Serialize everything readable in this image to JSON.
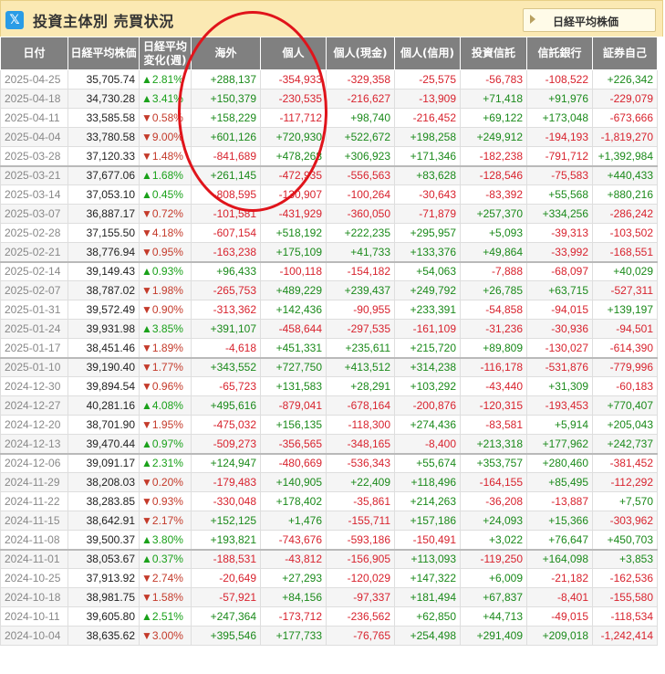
{
  "header": {
    "title": "投資主体別 売買状況",
    "nikkei_button": "日経平均株価"
  },
  "columns": [
    "日付",
    "日経平均株価",
    "日経平均\n変化(週)",
    "海外",
    "個人",
    "個人(現金)",
    "個人(信用)",
    "投資信託",
    "信託銀行",
    "証券自己"
  ],
  "rows": [
    {
      "date": "2025-04-25",
      "nikkei": "35,705.74",
      "dir": "up",
      "chg": "2.81%",
      "vals": [
        "+288,137",
        "-354,933",
        "-329,358",
        "-25,575",
        "-56,783",
        "-108,522",
        "+226,342"
      ]
    },
    {
      "date": "2025-04-18",
      "nikkei": "34,730.28",
      "dir": "up",
      "chg": "3.41%",
      "vals": [
        "+150,379",
        "-230,535",
        "-216,627",
        "-13,909",
        "+71,418",
        "+91,976",
        "-229,079"
      ]
    },
    {
      "date": "2025-04-11",
      "nikkei": "33,585.58",
      "dir": "down",
      "chg": "0.58%",
      "vals": [
        "+158,229",
        "-117,712",
        "+98,740",
        "-216,452",
        "+69,122",
        "+173,048",
        "-673,666"
      ]
    },
    {
      "date": "2025-04-04",
      "nikkei": "33,780.58",
      "dir": "down",
      "chg": "9.00%",
      "vals": [
        "+601,126",
        "+720,930",
        "+522,672",
        "+198,258",
        "+249,912",
        "-194,193",
        "-1,819,270"
      ]
    },
    {
      "date": "2025-03-28",
      "nikkei": "37,120.33",
      "dir": "down",
      "chg": "1.48%",
      "vals": [
        "-841,689",
        "+478,268",
        "+306,923",
        "+171,346",
        "-182,238",
        "-791,712",
        "+1,392,984"
      ]
    },
    {
      "date": "2025-03-21",
      "nikkei": "37,677.06",
      "dir": "up",
      "chg": "1.68%",
      "vals": [
        "+261,145",
        "-472,935",
        "-556,563",
        "+83,628",
        "-128,546",
        "-75,583",
        "+440,433"
      ]
    },
    {
      "date": "2025-03-14",
      "nikkei": "37,053.10",
      "dir": "up",
      "chg": "0.45%",
      "vals": [
        "-808,595",
        "-130,907",
        "-100,264",
        "-30,643",
        "-83,392",
        "+55,568",
        "+880,216"
      ]
    },
    {
      "date": "2025-03-07",
      "nikkei": "36,887.17",
      "dir": "down",
      "chg": "0.72%",
      "vals": [
        "-101,581",
        "-431,929",
        "-360,050",
        "-71,879",
        "+257,370",
        "+334,256",
        "-286,242"
      ]
    },
    {
      "date": "2025-02-28",
      "nikkei": "37,155.50",
      "dir": "down",
      "chg": "4.18%",
      "vals": [
        "-607,154",
        "+518,192",
        "+222,235",
        "+295,957",
        "+5,093",
        "-39,313",
        "-103,502"
      ]
    },
    {
      "date": "2025-02-21",
      "nikkei": "38,776.94",
      "dir": "down",
      "chg": "0.95%",
      "vals": [
        "-163,238",
        "+175,109",
        "+41,733",
        "+133,376",
        "+49,864",
        "-33,992",
        "-168,551"
      ]
    },
    {
      "date": "2025-02-14",
      "nikkei": "39,149.43",
      "dir": "up",
      "chg": "0.93%",
      "vals": [
        "+96,433",
        "-100,118",
        "-154,182",
        "+54,063",
        "-7,888",
        "-68,097",
        "+40,029"
      ]
    },
    {
      "date": "2025-02-07",
      "nikkei": "38,787.02",
      "dir": "down",
      "chg": "1.98%",
      "vals": [
        "-265,753",
        "+489,229",
        "+239,437",
        "+249,792",
        "+26,785",
        "+63,715",
        "-527,311"
      ]
    },
    {
      "date": "2025-01-31",
      "nikkei": "39,572.49",
      "dir": "down",
      "chg": "0.90%",
      "vals": [
        "-313,362",
        "+142,436",
        "-90,955",
        "+233,391",
        "-54,858",
        "-94,015",
        "+139,197"
      ]
    },
    {
      "date": "2025-01-24",
      "nikkei": "39,931.98",
      "dir": "up",
      "chg": "3.85%",
      "vals": [
        "+391,107",
        "-458,644",
        "-297,535",
        "-161,109",
        "-31,236",
        "-30,936",
        "-94,501"
      ]
    },
    {
      "date": "2025-01-17",
      "nikkei": "38,451.46",
      "dir": "down",
      "chg": "1.89%",
      "vals": [
        "-4,618",
        "+451,331",
        "+235,611",
        "+215,720",
        "+89,809",
        "-130,027",
        "-614,390"
      ]
    },
    {
      "date": "2025-01-10",
      "nikkei": "39,190.40",
      "dir": "down",
      "chg": "1.77%",
      "vals": [
        "+343,552",
        "+727,750",
        "+413,512",
        "+314,238",
        "-116,178",
        "-531,876",
        "-779,996"
      ]
    },
    {
      "date": "2024-12-30",
      "nikkei": "39,894.54",
      "dir": "down",
      "chg": "0.96%",
      "vals": [
        "-65,723",
        "+131,583",
        "+28,291",
        "+103,292",
        "-43,440",
        "+31,309",
        "-60,183"
      ]
    },
    {
      "date": "2024-12-27",
      "nikkei": "40,281.16",
      "dir": "up",
      "chg": "4.08%",
      "vals": [
        "+495,616",
        "-879,041",
        "-678,164",
        "-200,876",
        "-120,315",
        "-193,453",
        "+770,407"
      ]
    },
    {
      "date": "2024-12-20",
      "nikkei": "38,701.90",
      "dir": "down",
      "chg": "1.95%",
      "vals": [
        "-475,032",
        "+156,135",
        "-118,300",
        "+274,436",
        "-83,581",
        "+5,914",
        "+205,043"
      ]
    },
    {
      "date": "2024-12-13",
      "nikkei": "39,470.44",
      "dir": "up",
      "chg": "0.97%",
      "vals": [
        "-509,273",
        "-356,565",
        "-348,165",
        "-8,400",
        "+213,318",
        "+177,962",
        "+242,737"
      ]
    },
    {
      "date": "2024-12-06",
      "nikkei": "39,091.17",
      "dir": "up",
      "chg": "2.31%",
      "vals": [
        "+124,947",
        "-480,669",
        "-536,343",
        "+55,674",
        "+353,757",
        "+280,460",
        "-381,452"
      ]
    },
    {
      "date": "2024-11-29",
      "nikkei": "38,208.03",
      "dir": "down",
      "chg": "0.20%",
      "vals": [
        "-179,483",
        "+140,905",
        "+22,409",
        "+118,496",
        "-164,155",
        "+85,495",
        "-112,292"
      ]
    },
    {
      "date": "2024-11-22",
      "nikkei": "38,283.85",
      "dir": "down",
      "chg": "0.93%",
      "vals": [
        "-330,048",
        "+178,402",
        "-35,861",
        "+214,263",
        "-36,208",
        "-13,887",
        "+7,570"
      ]
    },
    {
      "date": "2024-11-15",
      "nikkei": "38,642.91",
      "dir": "down",
      "chg": "2.17%",
      "vals": [
        "+152,125",
        "+1,476",
        "-155,711",
        "+157,186",
        "+24,093",
        "+15,366",
        "-303,962"
      ]
    },
    {
      "date": "2024-11-08",
      "nikkei": "39,500.37",
      "dir": "up",
      "chg": "3.80%",
      "vals": [
        "+193,821",
        "-743,676",
        "-593,186",
        "-150,491",
        "+3,022",
        "+76,647",
        "+450,703"
      ]
    },
    {
      "date": "2024-11-01",
      "nikkei": "38,053.67",
      "dir": "up",
      "chg": "0.37%",
      "vals": [
        "-188,531",
        "-43,812",
        "-156,905",
        "+113,093",
        "-119,250",
        "+164,098",
        "+3,853"
      ]
    },
    {
      "date": "2024-10-25",
      "nikkei": "37,913.92",
      "dir": "down",
      "chg": "2.74%",
      "vals": [
        "-20,649",
        "+27,293",
        "-120,029",
        "+147,322",
        "+6,009",
        "-21,182",
        "-162,536"
      ]
    },
    {
      "date": "2024-10-18",
      "nikkei": "38,981.75",
      "dir": "down",
      "chg": "1.58%",
      "vals": [
        "-57,921",
        "+84,156",
        "-97,337",
        "+181,494",
        "+67,837",
        "-8,401",
        "-155,580"
      ]
    },
    {
      "date": "2024-10-11",
      "nikkei": "39,605.80",
      "dir": "up",
      "chg": "2.51%",
      "vals": [
        "+247,364",
        "-173,712",
        "-236,562",
        "+62,850",
        "+44,713",
        "-49,015",
        "-118,534"
      ]
    },
    {
      "date": "2024-10-04",
      "nikkei": "38,635.62",
      "dir": "down",
      "chg": "3.00%",
      "vals": [
        "+395,546",
        "+177,733",
        "-76,765",
        "+254,498",
        "+291,409",
        "+209,018",
        "-1,242,414"
      ]
    }
  ],
  "colors": {
    "positive": "#1b8a1b",
    "negative": "#d8232e",
    "header_bg": "#808080",
    "title_bg": "#fbe9b3",
    "annotation_circle": "#e0141b"
  },
  "icons": {
    "share": "x-logo-icon",
    "button_arrow": "triangle-right-icon",
    "up": "triangle-up",
    "down": "triangle-down"
  }
}
